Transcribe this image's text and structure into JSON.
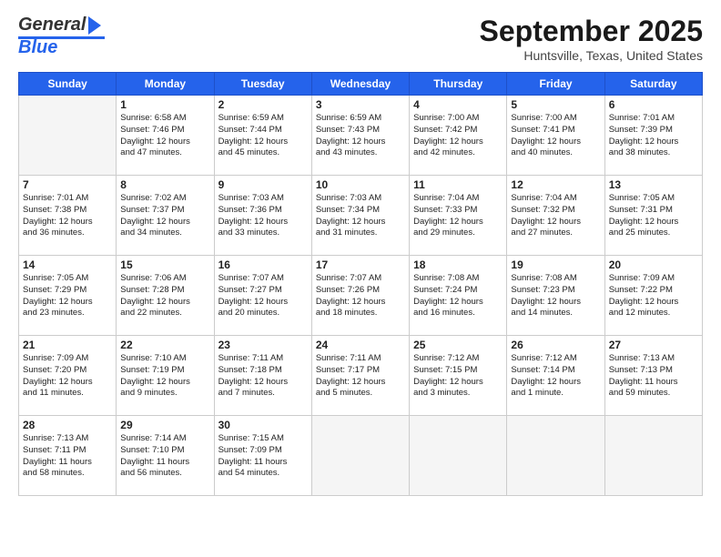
{
  "header": {
    "logo_general": "General",
    "logo_blue": "Blue",
    "title": "September 2025",
    "location": "Huntsville, Texas, United States"
  },
  "days_of_week": [
    "Sunday",
    "Monday",
    "Tuesday",
    "Wednesday",
    "Thursday",
    "Friday",
    "Saturday"
  ],
  "weeks": [
    [
      {
        "day": "",
        "content": ""
      },
      {
        "day": "1",
        "content": "Sunrise: 6:58 AM\nSunset: 7:46 PM\nDaylight: 12 hours\nand 47 minutes."
      },
      {
        "day": "2",
        "content": "Sunrise: 6:59 AM\nSunset: 7:44 PM\nDaylight: 12 hours\nand 45 minutes."
      },
      {
        "day": "3",
        "content": "Sunrise: 6:59 AM\nSunset: 7:43 PM\nDaylight: 12 hours\nand 43 minutes."
      },
      {
        "day": "4",
        "content": "Sunrise: 7:00 AM\nSunset: 7:42 PM\nDaylight: 12 hours\nand 42 minutes."
      },
      {
        "day": "5",
        "content": "Sunrise: 7:00 AM\nSunset: 7:41 PM\nDaylight: 12 hours\nand 40 minutes."
      },
      {
        "day": "6",
        "content": "Sunrise: 7:01 AM\nSunset: 7:39 PM\nDaylight: 12 hours\nand 38 minutes."
      }
    ],
    [
      {
        "day": "7",
        "content": "Sunrise: 7:01 AM\nSunset: 7:38 PM\nDaylight: 12 hours\nand 36 minutes."
      },
      {
        "day": "8",
        "content": "Sunrise: 7:02 AM\nSunset: 7:37 PM\nDaylight: 12 hours\nand 34 minutes."
      },
      {
        "day": "9",
        "content": "Sunrise: 7:03 AM\nSunset: 7:36 PM\nDaylight: 12 hours\nand 33 minutes."
      },
      {
        "day": "10",
        "content": "Sunrise: 7:03 AM\nSunset: 7:34 PM\nDaylight: 12 hours\nand 31 minutes."
      },
      {
        "day": "11",
        "content": "Sunrise: 7:04 AM\nSunset: 7:33 PM\nDaylight: 12 hours\nand 29 minutes."
      },
      {
        "day": "12",
        "content": "Sunrise: 7:04 AM\nSunset: 7:32 PM\nDaylight: 12 hours\nand 27 minutes."
      },
      {
        "day": "13",
        "content": "Sunrise: 7:05 AM\nSunset: 7:31 PM\nDaylight: 12 hours\nand 25 minutes."
      }
    ],
    [
      {
        "day": "14",
        "content": "Sunrise: 7:05 AM\nSunset: 7:29 PM\nDaylight: 12 hours\nand 23 minutes."
      },
      {
        "day": "15",
        "content": "Sunrise: 7:06 AM\nSunset: 7:28 PM\nDaylight: 12 hours\nand 22 minutes."
      },
      {
        "day": "16",
        "content": "Sunrise: 7:07 AM\nSunset: 7:27 PM\nDaylight: 12 hours\nand 20 minutes."
      },
      {
        "day": "17",
        "content": "Sunrise: 7:07 AM\nSunset: 7:26 PM\nDaylight: 12 hours\nand 18 minutes."
      },
      {
        "day": "18",
        "content": "Sunrise: 7:08 AM\nSunset: 7:24 PM\nDaylight: 12 hours\nand 16 minutes."
      },
      {
        "day": "19",
        "content": "Sunrise: 7:08 AM\nSunset: 7:23 PM\nDaylight: 12 hours\nand 14 minutes."
      },
      {
        "day": "20",
        "content": "Sunrise: 7:09 AM\nSunset: 7:22 PM\nDaylight: 12 hours\nand 12 minutes."
      }
    ],
    [
      {
        "day": "21",
        "content": "Sunrise: 7:09 AM\nSunset: 7:20 PM\nDaylight: 12 hours\nand 11 minutes."
      },
      {
        "day": "22",
        "content": "Sunrise: 7:10 AM\nSunset: 7:19 PM\nDaylight: 12 hours\nand 9 minutes."
      },
      {
        "day": "23",
        "content": "Sunrise: 7:11 AM\nSunset: 7:18 PM\nDaylight: 12 hours\nand 7 minutes."
      },
      {
        "day": "24",
        "content": "Sunrise: 7:11 AM\nSunset: 7:17 PM\nDaylight: 12 hours\nand 5 minutes."
      },
      {
        "day": "25",
        "content": "Sunrise: 7:12 AM\nSunset: 7:15 PM\nDaylight: 12 hours\nand 3 minutes."
      },
      {
        "day": "26",
        "content": "Sunrise: 7:12 AM\nSunset: 7:14 PM\nDaylight: 12 hours\nand 1 minute."
      },
      {
        "day": "27",
        "content": "Sunrise: 7:13 AM\nSunset: 7:13 PM\nDaylight: 11 hours\nand 59 minutes."
      }
    ],
    [
      {
        "day": "28",
        "content": "Sunrise: 7:13 AM\nSunset: 7:11 PM\nDaylight: 11 hours\nand 58 minutes."
      },
      {
        "day": "29",
        "content": "Sunrise: 7:14 AM\nSunset: 7:10 PM\nDaylight: 11 hours\nand 56 minutes."
      },
      {
        "day": "30",
        "content": "Sunrise: 7:15 AM\nSunset: 7:09 PM\nDaylight: 11 hours\nand 54 minutes."
      },
      {
        "day": "",
        "content": ""
      },
      {
        "day": "",
        "content": ""
      },
      {
        "day": "",
        "content": ""
      },
      {
        "day": "",
        "content": ""
      }
    ]
  ]
}
